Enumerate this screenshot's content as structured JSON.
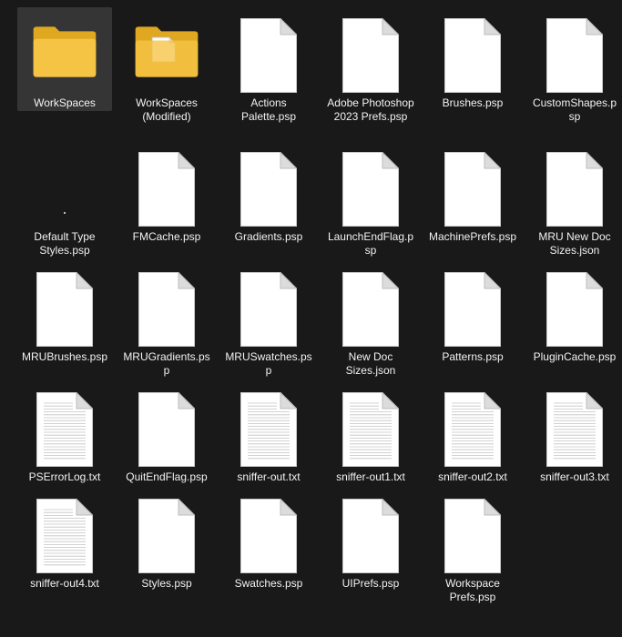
{
  "colors": {
    "background": "#191919",
    "selection": "#353535",
    "folder": "#f6c445",
    "file_page": "#ffffff"
  },
  "items": [
    {
      "name": "WorkSpaces",
      "type": "folder",
      "selected": true
    },
    {
      "name": "WorkSpaces (Modified)",
      "type": "folder-doc"
    },
    {
      "name": "Actions Palette.psp",
      "type": "file"
    },
    {
      "name": "Adobe Photoshop 2023 Prefs.psp",
      "type": "file"
    },
    {
      "name": "Brushes.psp",
      "type": "file"
    },
    {
      "name": "CustomShapes.psp",
      "type": "file"
    },
    {
      "name": "Default Type Styles.psp",
      "type": "blank"
    },
    {
      "name": "FMCache.psp",
      "type": "file"
    },
    {
      "name": "Gradients.psp",
      "type": "file"
    },
    {
      "name": "LaunchEndFlag.psp",
      "type": "file"
    },
    {
      "name": "MachinePrefs.psp",
      "type": "file"
    },
    {
      "name": "MRU New Doc Sizes.json",
      "type": "file"
    },
    {
      "name": "MRUBrushes.psp",
      "type": "file"
    },
    {
      "name": "MRUGradients.psp",
      "type": "file"
    },
    {
      "name": "MRUSwatches.psp",
      "type": "file"
    },
    {
      "name": "New Doc Sizes.json",
      "type": "file"
    },
    {
      "name": "Patterns.psp",
      "type": "file"
    },
    {
      "name": "PluginCache.psp",
      "type": "file"
    },
    {
      "name": "PSErrorLog.txt",
      "type": "text"
    },
    {
      "name": "QuitEndFlag.psp",
      "type": "file"
    },
    {
      "name": "sniffer-out.txt",
      "type": "text"
    },
    {
      "name": "sniffer-out1.txt",
      "type": "text"
    },
    {
      "name": "sniffer-out2.txt",
      "type": "text"
    },
    {
      "name": "sniffer-out3.txt",
      "type": "text"
    },
    {
      "name": "sniffer-out4.txt",
      "type": "text"
    },
    {
      "name": "Styles.psp",
      "type": "file"
    },
    {
      "name": "Swatches.psp",
      "type": "file"
    },
    {
      "name": "UIPrefs.psp",
      "type": "file"
    },
    {
      "name": "Workspace Prefs.psp",
      "type": "file"
    }
  ]
}
